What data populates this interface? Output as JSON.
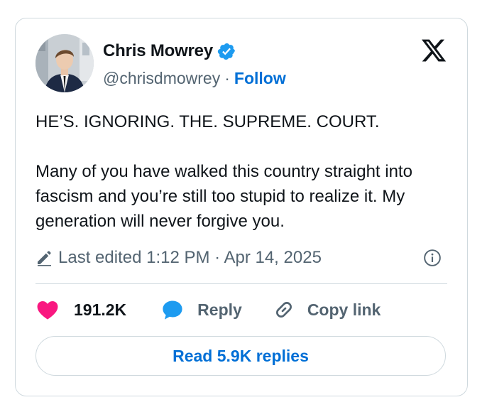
{
  "author": {
    "name": "Chris Mowrey",
    "handle": "@chrisdmowrey",
    "separator": "·",
    "follow_label": "Follow"
  },
  "tweet": {
    "line1": "HE’S. IGNORING. THE. SUPREME. COURT.",
    "line2": "Many of you have walked this country straight into fascism and you’re still too stupid to realize it. My generation will never forgive you."
  },
  "meta": {
    "edited_text": "Last edited 1:12 PM · Apr 14, 2025"
  },
  "actions": {
    "like_count": "191.2K",
    "reply_label": "Reply",
    "copy_link_label": "Copy link"
  },
  "footer": {
    "read_replies_label": "Read 5.9K replies"
  },
  "colors": {
    "accent": "#006fd6",
    "like": "#f91880",
    "reply_icon": "#1d9bf0",
    "muted": "#536471",
    "border": "#cfd9de"
  },
  "icons": {
    "verified": "verified-badge-icon",
    "logo": "x-logo-icon",
    "edit": "pencil-icon",
    "info": "info-icon",
    "like": "heart-icon",
    "reply": "speech-bubble-icon",
    "copy": "link-icon"
  }
}
